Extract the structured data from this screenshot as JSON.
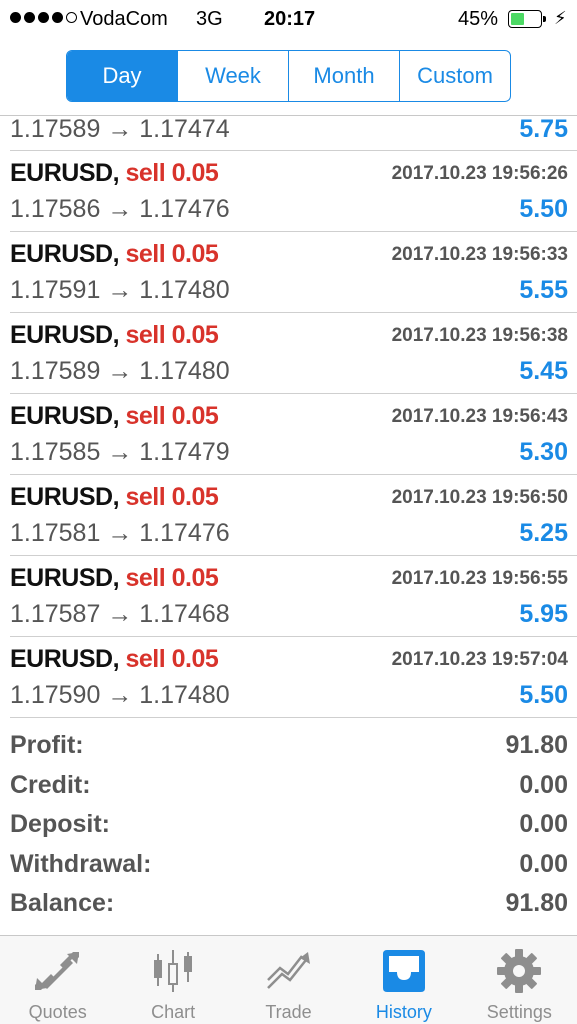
{
  "status_bar": {
    "carrier": "VodaCom",
    "network": "3G",
    "time": "20:17",
    "battery_percent": "45%",
    "battery_level": 0.45,
    "signal_bars": 4,
    "signal_max": 5,
    "battery_color": "#4cd964"
  },
  "period_selector": {
    "options": [
      "Day",
      "Week",
      "Month",
      "Custom"
    ],
    "selected": "Day",
    "accent_color": "#1a8ae5"
  },
  "deals": {
    "partial_top": {
      "prices": "1.17589 → 1.17474",
      "profit": "5.75"
    },
    "items": [
      {
        "symbol": "EURUSD",
        "type": "sell 0.05",
        "time": "2017.10.23 19:56:26",
        "prices": "1.17586 → 1.17476",
        "profit": "5.50"
      },
      {
        "symbol": "EURUSD",
        "type": "sell 0.05",
        "time": "2017.10.23 19:56:33",
        "prices": "1.17591 → 1.17480",
        "profit": "5.55"
      },
      {
        "symbol": "EURUSD",
        "type": "sell 0.05",
        "time": "2017.10.23 19:56:38",
        "prices": "1.17589 → 1.17480",
        "profit": "5.45"
      },
      {
        "symbol": "EURUSD",
        "type": "sell 0.05",
        "time": "2017.10.23 19:56:43",
        "prices": "1.17585 → 1.17479",
        "profit": "5.30"
      },
      {
        "symbol": "EURUSD",
        "type": "sell 0.05",
        "time": "2017.10.23 19:56:50",
        "prices": "1.17581 → 1.17476",
        "profit": "5.25"
      },
      {
        "symbol": "EURUSD",
        "type": "sell 0.05",
        "time": "2017.10.23 19:56:55",
        "prices": "1.17587 → 1.17468",
        "profit": "5.95"
      },
      {
        "symbol": "EURUSD",
        "type": "sell 0.05",
        "time": "2017.10.23 19:57:04",
        "prices": "1.17590 → 1.17480",
        "profit": "5.50"
      }
    ],
    "sell_color": "#d8332b",
    "profit_color": "#1a8ae5"
  },
  "summary": {
    "profit_label": "Profit:",
    "profit_value": "91.80",
    "credit_label": "Credit:",
    "credit_value": "0.00",
    "deposit_label": "Deposit:",
    "deposit_value": "0.00",
    "withdrawal_label": "Withdrawal:",
    "withdrawal_value": "0.00",
    "balance_label": "Balance:",
    "balance_value": "91.80"
  },
  "tab_bar": {
    "tabs": [
      {
        "label": "Quotes",
        "icon": "quotes-arrows-icon"
      },
      {
        "label": "Chart",
        "icon": "candlestick-chart-icon"
      },
      {
        "label": "Trade",
        "icon": "trade-trend-icon"
      },
      {
        "label": "History",
        "icon": "history-inbox-icon"
      },
      {
        "label": "Settings",
        "icon": "gear-icon"
      }
    ],
    "active": "History",
    "active_color": "#1a8ae5",
    "inactive_color": "#8e8e8e"
  }
}
